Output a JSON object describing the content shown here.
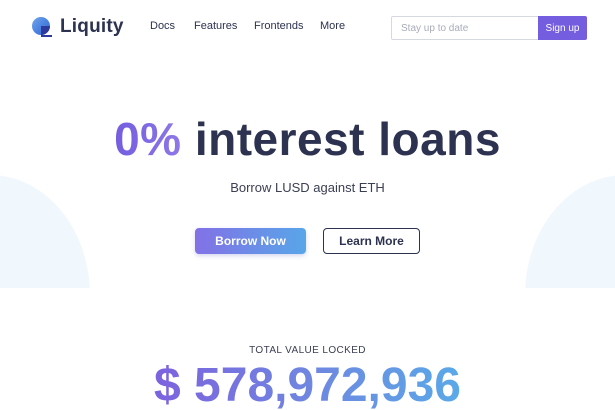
{
  "header": {
    "brand": "Liquity",
    "logo_icon": "liquity-logo-icon",
    "nav": [
      {
        "label": "Docs"
      },
      {
        "label": "Features"
      },
      {
        "label": "Frontends"
      },
      {
        "label": "More"
      }
    ],
    "subscribe": {
      "placeholder": "Stay up to date",
      "value": "",
      "button_label": "Sign up"
    }
  },
  "hero": {
    "title_accent": "0%",
    "title_rest": " interest loans",
    "subtitle": "Borrow LUSD against ETH",
    "primary_button": "Borrow Now",
    "secondary_button": "Learn More"
  },
  "tvl": {
    "label": "TOTAL VALUE LOCKED",
    "value": "$ 578,972,936"
  },
  "colors": {
    "brand_purple": "#745ddf",
    "text_dark": "#2c3250",
    "accent_blue": "#58a6e8",
    "blob_bg": "#f1f8fd"
  }
}
